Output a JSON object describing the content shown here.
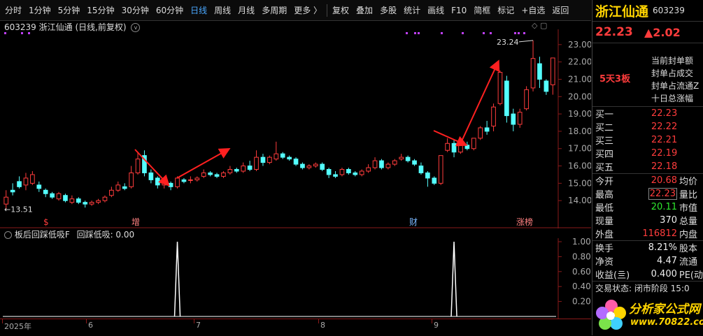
{
  "toolbar": {
    "left_items": [
      "分时",
      "1分钟",
      "5分钟",
      "15分钟",
      "30分钟",
      "60分钟",
      "日线",
      "周线",
      "月线",
      "多周期",
      "更多 〉"
    ],
    "active_index": 6,
    "right_items": [
      "复权",
      "叠加",
      "多股",
      "统计",
      "画线",
      "F10",
      "简框",
      "标记",
      "+自选",
      "返回"
    ]
  },
  "chart": {
    "title": "603239 浙江仙通 (日线,前复权)",
    "high_label": "23.24",
    "low_label": "←13.51",
    "price_ticks": [
      "23.00",
      "22.00",
      "21.00",
      "20.00",
      "19.00",
      "18.00",
      "17.00",
      "16.00",
      "15.00",
      "14.00"
    ],
    "markers": [
      {
        "text": "$",
        "color": "#ff3c3c"
      },
      {
        "text": "增",
        "color": "#ff8080"
      },
      {
        "text": "财",
        "color": "#7ab8ff"
      },
      {
        "text": "涨榜",
        "color": "#ff8080"
      }
    ]
  },
  "indicator": {
    "title": "板后回踩低吸F",
    "value_label": "回踩低吸: 0.00",
    "ticks": [
      "1.00",
      "0.80",
      "0.60",
      "0.40",
      "0.20"
    ]
  },
  "date_axis": [
    "2025年",
    "6",
    "7",
    "8",
    "9"
  ],
  "panel": {
    "name": "浙江仙通",
    "code": "603239",
    "price": "22.23",
    "change": "▲2.02",
    "board_tag": "5天3板",
    "board_lines": [
      "当前封单额",
      "封单占成交",
      "封单占流通Z",
      "十日总涨幅"
    ],
    "bids": [
      {
        "label": "买一",
        "value": "22.23"
      },
      {
        "label": "买二",
        "value": "22.22"
      },
      {
        "label": "买三",
        "value": "22.21"
      },
      {
        "label": "买四",
        "value": "22.19"
      },
      {
        "label": "买五",
        "value": "22.18"
      }
    ],
    "quotes": [
      {
        "l1": "今开",
        "v": "20.68",
        "c": "red",
        "l2": "均价"
      },
      {
        "l1": "最高",
        "v": "22.23",
        "c": "red",
        "l2": "量比",
        "hl": true
      },
      {
        "l1": "最低",
        "v": "20.11",
        "c": "green",
        "l2": "市值"
      },
      {
        "l1": "现量",
        "v": "370",
        "c": "white",
        "l2": "总量"
      },
      {
        "l1": "外盘",
        "v": "116812",
        "c": "red",
        "l2": "内盘"
      }
    ],
    "stats": [
      {
        "l1": "换手",
        "v": "8.21%",
        "l2": "股本"
      },
      {
        "l1": "净资",
        "v": "4.47",
        "l2": "流通"
      },
      {
        "l1": "收益(亖)",
        "v": "0.400",
        "l2": "PE(动"
      }
    ],
    "status": "交易状态: 闭市阶段 15:0",
    "logo_text": "分析家公式网",
    "logo_url": "www.70822.com"
  },
  "chart_data": {
    "type": "candlestick",
    "title": "603239 浙江仙通 (日线,前复权)",
    "x_labels": [
      "2025年",
      "6",
      "7",
      "8",
      "9"
    ],
    "ylim": [
      13.0,
      23.8
    ],
    "annotations": {
      "high": "23.24",
      "low": "13.51"
    },
    "candles": [
      [
        13.8,
        14.2,
        13.5,
        14.6
      ],
      [
        14.6,
        14.5,
        14.3,
        15.0
      ],
      [
        15.1,
        14.8,
        14.7,
        15.4
      ],
      [
        14.9,
        15.3,
        14.6,
        15.6
      ],
      [
        15.0,
        15.5,
        14.9,
        15.7
      ],
      [
        14.9,
        14.7,
        14.5,
        15.1
      ],
      [
        14.6,
        14.4,
        14.2,
        14.7
      ],
      [
        14.4,
        14.2,
        14.1,
        14.5
      ],
      [
        14.1,
        14.4,
        14.0,
        14.5
      ],
      [
        14.3,
        14.0,
        13.9,
        14.4
      ],
      [
        13.9,
        14.1,
        13.8,
        14.3
      ],
      [
        14.1,
        13.9,
        13.8,
        14.2
      ],
      [
        13.9,
        13.8,
        13.6,
        14.0
      ],
      [
        13.8,
        13.9,
        13.7,
        14.0
      ],
      [
        13.9,
        14.0,
        13.8,
        14.1
      ],
      [
        14.0,
        14.2,
        13.9,
        14.3
      ],
      [
        14.3,
        14.6,
        14.2,
        14.8
      ],
      [
        14.6,
        14.9,
        14.5,
        15.1
      ],
      [
        14.8,
        14.7,
        14.6,
        15.0
      ],
      [
        14.8,
        15.6,
        14.7,
        16.0
      ],
      [
        15.6,
        16.4,
        15.5,
        16.8
      ],
      [
        16.6,
        15.6,
        15.4,
        16.9
      ],
      [
        15.6,
        15.2,
        15.0,
        15.8
      ],
      [
        15.3,
        14.9,
        14.7,
        15.4
      ],
      [
        14.9,
        15.0,
        14.7,
        15.2
      ],
      [
        15.0,
        14.8,
        14.6,
        15.1
      ],
      [
        14.8,
        15.3,
        14.7,
        15.4
      ],
      [
        15.2,
        15.1,
        15.0,
        15.3
      ],
      [
        15.2,
        15.2,
        15.0,
        15.4
      ],
      [
        15.2,
        15.3,
        15.1,
        15.4
      ],
      [
        15.4,
        15.6,
        15.3,
        15.8
      ],
      [
        15.6,
        15.5,
        15.4,
        15.7
      ],
      [
        15.5,
        15.4,
        15.3,
        15.6
      ],
      [
        15.4,
        15.6,
        15.3,
        15.7
      ],
      [
        15.6,
        15.8,
        15.5,
        16.0
      ],
      [
        15.8,
        15.7,
        15.6,
        15.9
      ],
      [
        15.7,
        16.0,
        15.6,
        16.2
      ],
      [
        16.0,
        15.8,
        15.7,
        16.3
      ],
      [
        15.8,
        16.5,
        15.7,
        16.9
      ],
      [
        16.5,
        16.2,
        16.0,
        16.7
      ],
      [
        16.2,
        16.5,
        16.1,
        16.6
      ],
      [
        16.4,
        16.7,
        16.3,
        17.4
      ],
      [
        16.7,
        16.5,
        16.4,
        16.8
      ],
      [
        16.5,
        16.4,
        16.3,
        16.6
      ],
      [
        16.4,
        16.1,
        16.0,
        16.5
      ],
      [
        16.1,
        15.9,
        15.8,
        16.2
      ],
      [
        15.9,
        16.0,
        15.8,
        16.1
      ],
      [
        16.0,
        16.1,
        15.9,
        16.2
      ],
      [
        16.1,
        15.8,
        15.7,
        16.2
      ],
      [
        15.8,
        15.5,
        15.3,
        15.9
      ],
      [
        15.5,
        15.4,
        15.3,
        15.7
      ],
      [
        15.5,
        15.8,
        15.4,
        15.9
      ],
      [
        15.8,
        15.6,
        15.5,
        15.9
      ],
      [
        15.6,
        15.5,
        15.4,
        15.7
      ],
      [
        15.5,
        15.7,
        15.4,
        15.8
      ],
      [
        15.7,
        15.9,
        15.6,
        16.1
      ],
      [
        15.9,
        16.3,
        15.8,
        16.5
      ],
      [
        16.3,
        15.9,
        15.8,
        16.4
      ],
      [
        15.9,
        16.1,
        15.8,
        16.2
      ],
      [
        16.1,
        16.3,
        16.0,
        16.4
      ],
      [
        16.4,
        16.5,
        16.3,
        16.7
      ],
      [
        16.5,
        16.3,
        16.2,
        16.6
      ],
      [
        16.3,
        16.1,
        16.0,
        16.4
      ],
      [
        16.0,
        15.6,
        15.5,
        16.2
      ],
      [
        15.6,
        15.3,
        14.8,
        15.7
      ],
      [
        15.3,
        15.0,
        14.9,
        15.4
      ],
      [
        15.0,
        16.6,
        14.9,
        16.6
      ],
      [
        16.9,
        17.3,
        16.8,
        17.6
      ],
      [
        17.3,
        16.8,
        16.5,
        17.5
      ],
      [
        16.8,
        17.2,
        16.7,
        17.5
      ],
      [
        17.2,
        17.0,
        16.9,
        17.4
      ],
      [
        17.0,
        17.6,
        16.9,
        17.6
      ],
      [
        17.6,
        18.2,
        17.5,
        18.3
      ],
      [
        18.2,
        18.0,
        17.8,
        18.6
      ],
      [
        18.3,
        19.4,
        18.0,
        19.6
      ],
      [
        19.6,
        21.4,
        19.5,
        21.5
      ],
      [
        20.9,
        18.9,
        18.5,
        21.2
      ],
      [
        19.0,
        18.4,
        18.0,
        19.3
      ],
      [
        18.4,
        19.1,
        18.2,
        19.3
      ],
      [
        19.3,
        20.4,
        19.2,
        20.6
      ],
      [
        20.5,
        22.2,
        20.3,
        23.24
      ],
      [
        21.9,
        21.0,
        20.5,
        22.3
      ],
      [
        20.9,
        20.3,
        20.1,
        21.0
      ],
      [
        20.68,
        22.23,
        20.11,
        22.23
      ]
    ],
    "indicator_series": {
      "name": "回踩低吸",
      "spikes_at_index": [
        26,
        68
      ],
      "ylim": [
        0,
        1.0
      ]
    }
  }
}
